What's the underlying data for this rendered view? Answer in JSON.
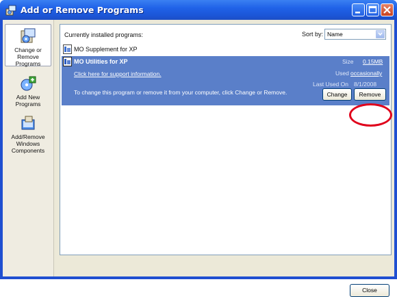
{
  "window": {
    "title": "Add or Remove Programs"
  },
  "sidebar": {
    "items": [
      {
        "label": "Change or Remove Programs",
        "icon": "change-remove-programs-icon"
      },
      {
        "label": "Add New Programs",
        "icon": "add-new-programs-icon"
      },
      {
        "label": "Add/Remove Windows Components",
        "icon": "windows-components-icon"
      }
    ]
  },
  "list": {
    "header_label": "Currently installed programs:",
    "sort_label": "Sort by:",
    "sort_value": "Name",
    "programs": [
      {
        "name": "MO Supplement for XP"
      },
      {
        "name": "MO Utilities for XP",
        "support_link": "Click here for support information.",
        "hint": "To change this program or remove it from your computer, click Change or Remove.",
        "size_label": "Size",
        "size_value": "0.15MB",
        "used_label": "Used",
        "used_value": "occasionally",
        "last_used_label": "Last Used On",
        "last_used_value": "8/1/2008",
        "change_label": "Change",
        "remove_label": "Remove"
      }
    ]
  },
  "footer": {
    "close_label": "Close"
  },
  "colors": {
    "selection": "#5a7fc9",
    "highlight_circle": "#e0001b",
    "titlebar": "#2062e8"
  }
}
